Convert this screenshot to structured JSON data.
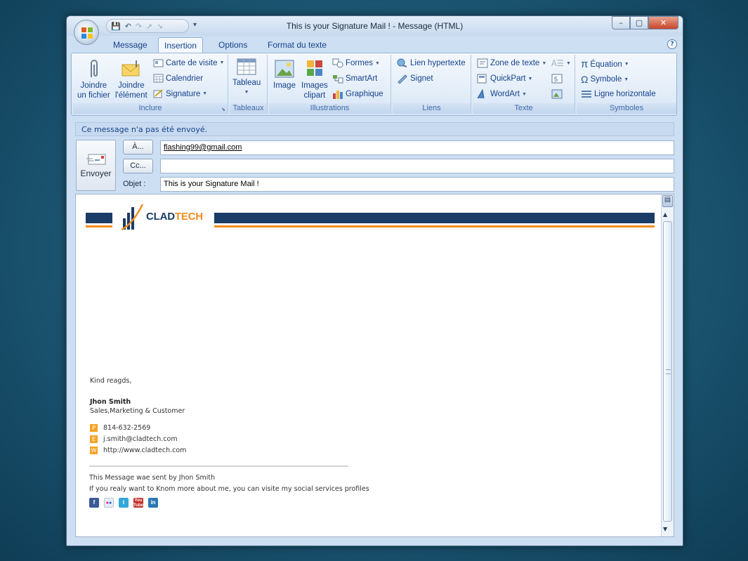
{
  "window": {
    "title": "This is your Signature Mail ! - Message (HTML)"
  },
  "quick_access": {
    "icons": [
      "save-icon",
      "undo-icon",
      "redo-icon",
      "up-arrow-icon",
      "down-arrow-icon",
      "customize-icon"
    ]
  },
  "tabs": [
    {
      "label": "Message",
      "active": false
    },
    {
      "label": "Insertion",
      "active": true
    },
    {
      "label": "Options",
      "active": false
    },
    {
      "label": "Format du texte",
      "active": false
    }
  ],
  "ribbon": {
    "groups": {
      "inclure": {
        "label": "Inclure"
      },
      "tableaux": {
        "label": "Tableaux"
      },
      "illustrations": {
        "label": "Illustrations"
      },
      "liens": {
        "label": "Liens"
      },
      "texte": {
        "label": "Texte"
      },
      "symboles": {
        "label": "Symboles"
      }
    },
    "buttons": {
      "joindre_fichier_1": "Joindre",
      "joindre_fichier_2": "un fichier",
      "joindre_element_1": "Joindre",
      "joindre_element_2": "l'élément",
      "carte_visite": "Carte de visite",
      "calendrier": "Calendrier",
      "signature": "Signature",
      "tableau": "Tableau",
      "image": "Image",
      "images_clipart_1": "Images",
      "images_clipart_2": "clipart",
      "formes": "Formes",
      "smartart": "SmartArt",
      "graphique": "Graphique",
      "lien_hypertexte": "Lien hypertexte",
      "signet": "Signet",
      "zone_texte": "Zone de texte",
      "quickpart": "QuickPart",
      "wordart": "WordArt",
      "equation": "Équation",
      "symbole": "Symbole",
      "ligne_horizontale": "Ligne horizontale"
    }
  },
  "notice": "Ce message n'a pas été envoyé.",
  "compose": {
    "send_label": "Envoyer",
    "to_label": "À...",
    "cc_label": "Cc...",
    "subject_label": "Objet :",
    "to_value": "flashing99@gmail.com",
    "cc_value": "",
    "subject_value": "This is your Signature Mail !"
  },
  "signature": {
    "brand_part1": "CLAD",
    "brand_part2": "TECH",
    "greeting": "Kind reagds,",
    "name": "Jhon Smith",
    "role": "Sales,Marketing & Customer",
    "contacts": [
      {
        "letter": "P",
        "value": "814-632-2569"
      },
      {
        "letter": "E",
        "value": "j.smith@cladtech.com"
      },
      {
        "letter": "W",
        "value": "http://www.cladtech.com"
      }
    ],
    "sent_by": "This Message wae sent by  Jhon Smith",
    "social_text": "If you realy want to Knom more about me, you can visite my social services profiles",
    "social": [
      {
        "icon": "facebook-icon",
        "glyph": "f",
        "color": "#3b5998"
      },
      {
        "icon": "flickr-icon",
        "glyph": "••",
        "color": "#e8eef6"
      },
      {
        "icon": "twitter-icon",
        "glyph": "t",
        "color": "#33a7d8"
      },
      {
        "icon": "youtube-icon",
        "glyph": "You",
        "color": "#c4302b"
      },
      {
        "icon": "linkedin-icon",
        "glyph": "in",
        "color": "#2a78b4"
      }
    ],
    "colors": {
      "navy": "#1a3c66",
      "orange": "#f18d1e"
    }
  }
}
